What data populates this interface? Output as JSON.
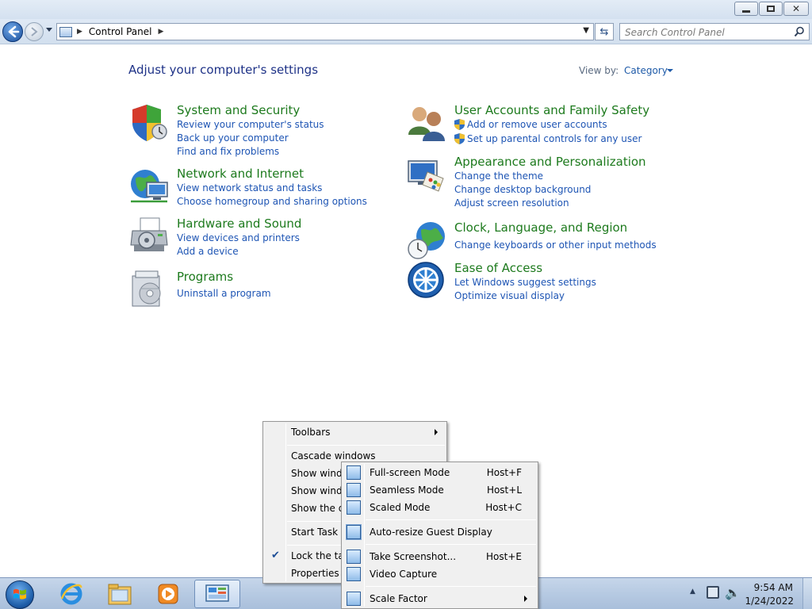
{
  "window": {
    "address": {
      "crumb": "Control Panel"
    },
    "search": {
      "placeholder": "Search Control Panel"
    }
  },
  "content": {
    "title": "Adjust your computer's settings",
    "view_by": {
      "label": "View by:",
      "value": "Category"
    },
    "categories": [
      {
        "title": "System and Security",
        "icon": "shield-icon",
        "links": [
          "Review your computer's status",
          "Back up your computer",
          "Find and fix problems"
        ]
      },
      {
        "title": "Network and Internet",
        "icon": "globe-network-icon",
        "links": [
          "View network status and tasks",
          "Choose homegroup and sharing options"
        ]
      },
      {
        "title": "Hardware and Sound",
        "icon": "printer-icon",
        "links": [
          "View devices and printers",
          "Add a device"
        ]
      },
      {
        "title": "Programs",
        "icon": "programs-icon",
        "links": [
          "Uninstall a program"
        ]
      },
      {
        "title": "User Accounts and Family Safety",
        "icon": "users-icon",
        "links": [
          "Add or remove user accounts",
          "Set up parental controls for any user"
        ]
      },
      {
        "title": "Appearance and Personalization",
        "icon": "monitor-palette-icon",
        "links": [
          "Change the theme",
          "Change desktop background",
          "Adjust screen resolution"
        ]
      },
      {
        "title": "Clock, Language, and Region",
        "icon": "globe-clock-icon",
        "links": [
          "Change keyboards or other input methods"
        ]
      },
      {
        "title": "Ease of Access",
        "icon": "ease-of-access-icon",
        "links": [
          "Let Windows suggest settings",
          "Optimize visual display"
        ]
      }
    ]
  },
  "taskbar_menu": {
    "items": [
      "Toolbars",
      "Cascade windows",
      "Show windo",
      "Show windo",
      "Show the de",
      "Start Task M",
      "Lock the tas",
      "Properties"
    ]
  },
  "vbox_menu": {
    "items": [
      {
        "label": "Full-screen Mode",
        "key": "Host+F"
      },
      {
        "label": "Seamless Mode",
        "key": "Host+L"
      },
      {
        "label": "Scaled Mode",
        "key": "Host+C"
      },
      {
        "label": "Auto-resize Guest Display",
        "key": ""
      },
      {
        "label": "Take Screenshot...",
        "key": "Host+E"
      },
      {
        "label": "Video Capture",
        "key": ""
      },
      {
        "label": "Scale Factor",
        "key": ""
      }
    ]
  },
  "tray": {
    "time": "9:54 AM",
    "date": "1/24/2022"
  },
  "colors": {
    "link": "#1e55b4",
    "category_title": "#1d7a1d",
    "heading": "#1e3287"
  }
}
